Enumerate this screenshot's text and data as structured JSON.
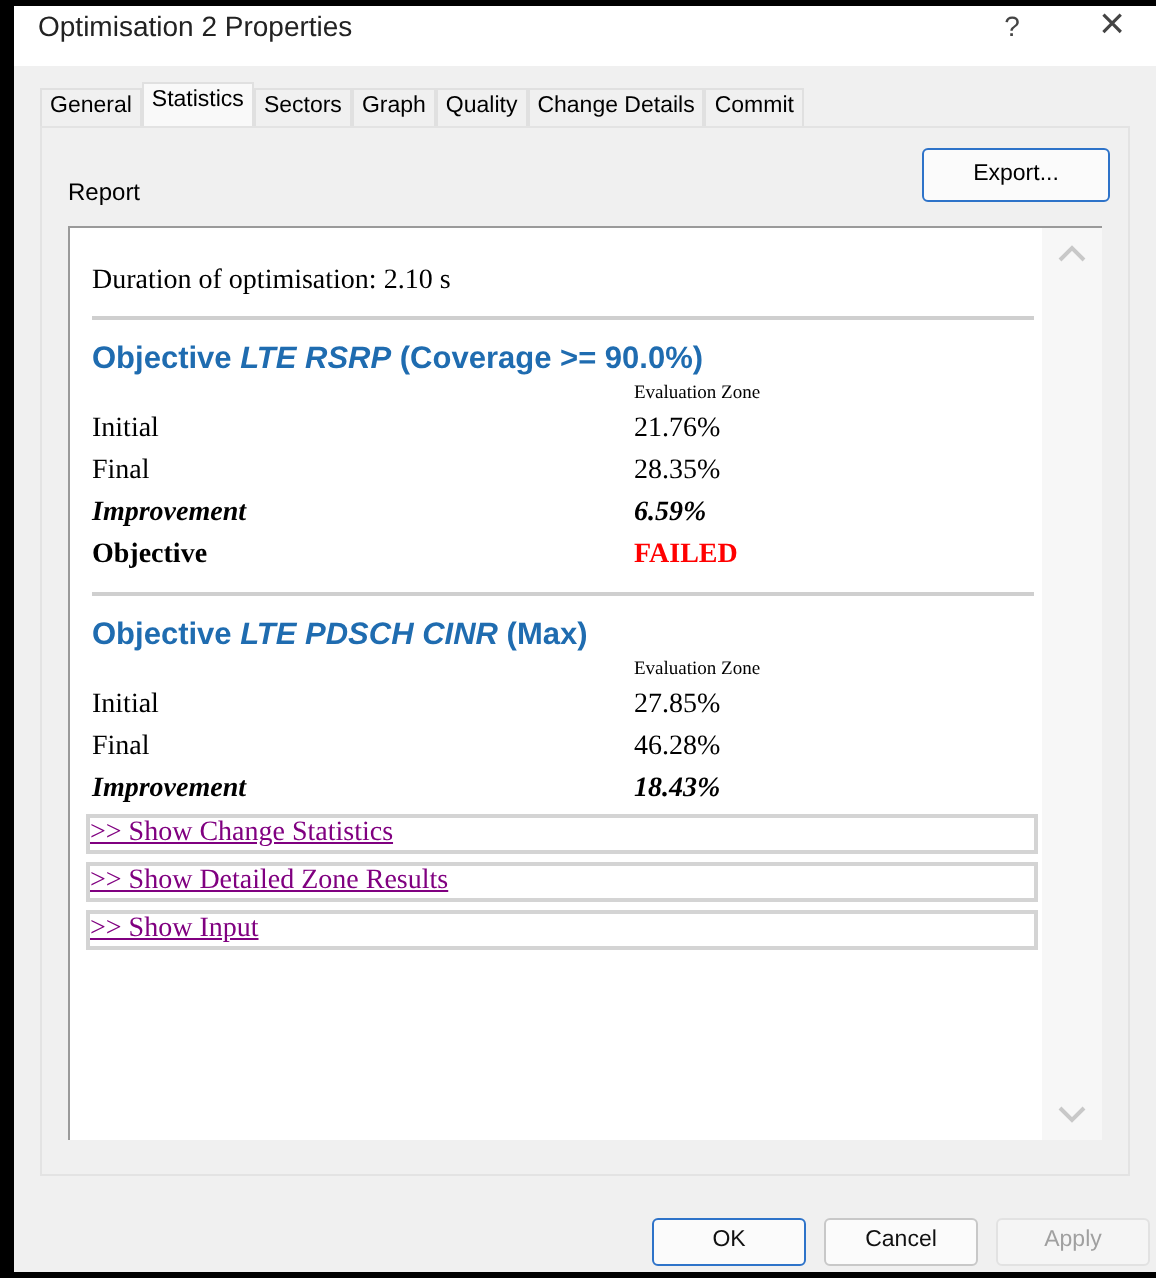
{
  "window": {
    "title": "Optimisation 2 Properties",
    "help": "?",
    "close": "×"
  },
  "tabs": [
    {
      "label": "General",
      "selected": false
    },
    {
      "label": "Statistics",
      "selected": true
    },
    {
      "label": "Sectors",
      "selected": false
    },
    {
      "label": "Graph",
      "selected": false
    },
    {
      "label": "Quality",
      "selected": false
    },
    {
      "label": "Change Details",
      "selected": false
    },
    {
      "label": "Commit",
      "selected": false
    }
  ],
  "report": {
    "label": "Report",
    "export_button": "Export...",
    "duration": "Duration of optimisation: 2.10 s",
    "objectives": [
      {
        "heading": "Objective *LTE RSRP* (Coverage >= 90.0%)",
        "column": "Evaluation Zone",
        "rows": [
          {
            "kind": "plain",
            "label": "Initial",
            "value": "21.76%"
          },
          {
            "kind": "plain",
            "label": "Final",
            "value": "28.35%"
          },
          {
            "kind": "emphasis",
            "label": "Improvement",
            "value": "6.59%"
          },
          {
            "kind": "status",
            "label": "Objective",
            "value": "FAILED"
          }
        ]
      },
      {
        "heading": "Objective *LTE PDSCH CINR* (Max)",
        "column": "Evaluation Zone",
        "rows": [
          {
            "kind": "plain",
            "label": "Initial",
            "value": "27.85%"
          },
          {
            "kind": "plain",
            "label": "Final",
            "value": "46.28%"
          },
          {
            "kind": "emphasis",
            "label": "Improvement",
            "value": "18.43%"
          }
        ]
      }
    ],
    "links": [
      ">> Show Change Statistics",
      ">> Show Detailed Zone Results",
      ">> Show Input"
    ]
  },
  "buttons": [
    {
      "label": "OK",
      "disabled": false,
      "default": true
    },
    {
      "label": "Cancel",
      "disabled": false,
      "default": false
    },
    {
      "label": "Apply",
      "disabled": true,
      "default": false
    }
  ]
}
